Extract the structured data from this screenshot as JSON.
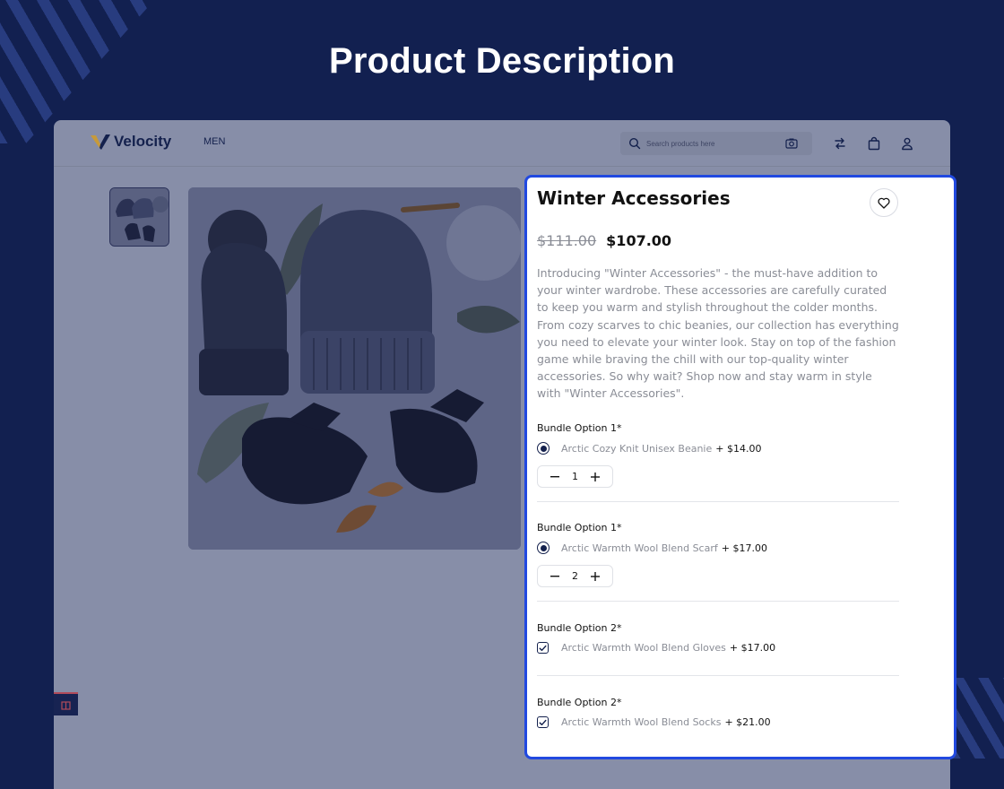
{
  "hero": {
    "title": "Product Description"
  },
  "nav": {
    "brand": "Velocity",
    "menu_men": "MEN",
    "search_placeholder": "Search products here",
    "icons": [
      "search-icon",
      "camera-icon",
      "compare-icon",
      "cart-icon",
      "account-icon"
    ]
  },
  "product": {
    "title": "Winter Accessories",
    "price_old": "$111.00",
    "price_new": "$107.00",
    "description": "Introducing \"Winter Accessories\" - the must-have addition to your winter wardrobe. These accessories are carefully curated to keep you warm and stylish throughout the colder months. From cozy scarves to chic beanies, our collection has everything you need to elevate your winter look. Stay on top of the fashion game while braving the chill with our top-quality winter accessories. So why wait? Shop now and stay warm in style with \"Winter Accessories\"."
  },
  "options": [
    {
      "label": "Bundle Option 1*",
      "type": "radio",
      "name": "Arctic Cozy Knit Unisex Beanie",
      "price": "+ $14.00",
      "qty": "1"
    },
    {
      "label": "Bundle Option 1*",
      "type": "radio",
      "name": "Arctic Warmth Wool Blend Scarf",
      "price": "+ $17.00",
      "qty": "2"
    },
    {
      "label": "Bundle Option 2*",
      "type": "checkbox",
      "name": "Arctic Warmth Wool Blend Gloves",
      "price": "+ $17.00"
    },
    {
      "label": "Bundle Option 2*",
      "type": "checkbox",
      "name": "Arctic Warmth Wool Blend Socks",
      "price": "+ $21.00"
    }
  ],
  "colors": {
    "accent_border": "#2149e0",
    "brand_navy": "#14214d",
    "backdrop": "#122050"
  }
}
